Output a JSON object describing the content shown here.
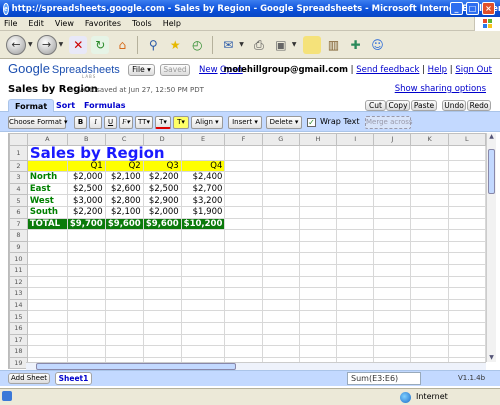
{
  "window": {
    "title": "http://spreadsheets.google.com - Sales by Region - Google Spreadsheets - Microsoft Internet Explorer"
  },
  "menu": [
    "File",
    "Edit",
    "View",
    "Favorites",
    "Tools",
    "Help"
  ],
  "app": {
    "logo_google": "Google",
    "logo_product": "Spreadsheets",
    "logo_sub": "LABS",
    "file_button": "File ▾",
    "saved_button": "Saved",
    "new_link": "New",
    "open_link": "Open",
    "account_email": "molehillgroup@gmail.com",
    "links": {
      "feedback": "Send feedback",
      "help": "Help",
      "signout": "Sign Out"
    },
    "doc_title": "Sales by Region",
    "autosave": "Autosaved at Jun 27, 12:50 PM PDT",
    "sharing": "Show sharing options"
  },
  "tabs": [
    "Format",
    "Sort",
    "Formulas"
  ],
  "edit_buttons": [
    "Cut",
    "Copy",
    "Paste",
    "Undo",
    "Redo"
  ],
  "format_toolbar": {
    "choose_format": "Choose Format ▾",
    "bold": "B",
    "italic": "I",
    "underline": "U",
    "font": "F▾",
    "size": "TT▾",
    "text_color": "T▾",
    "bg_color": "T▾",
    "align": "Align ▾",
    "insert": "Insert ▾",
    "delete": "Delete ▾",
    "wrap_text": "Wrap Text",
    "merge": "Merge across"
  },
  "grid": {
    "columns": [
      "A",
      "B",
      "C",
      "D",
      "E",
      "F",
      "G",
      "H",
      "I",
      "J",
      "K",
      "L"
    ],
    "title": "Sales by Region",
    "headers": [
      "",
      "Q1",
      "Q2",
      "Q3",
      "Q4"
    ],
    "rows": [
      [
        "North",
        "$2,000",
        "$2,100",
        "$2,200",
        "$2,400"
      ],
      [
        "East",
        "$2,500",
        "$2,600",
        "$2,500",
        "$2,700"
      ],
      [
        "West",
        "$3,000",
        "$2,800",
        "$2,900",
        "$3,200"
      ],
      [
        "South",
        "$2,200",
        "$2,100",
        "$2,000",
        "$1,900"
      ]
    ],
    "total": [
      "TOTAL",
      "$9,700",
      "$9,600",
      "$9,600",
      "$10,200"
    ],
    "row_count": 20
  },
  "bottom": {
    "add_sheet": "Add Sheet",
    "sheet_tab": "Sheet1 ▾",
    "formula": "Sum(E3:E6)",
    "version": "V1.1.4b"
  },
  "status": {
    "zone": "Internet"
  },
  "colors": {
    "title_text": "#1a1aff",
    "header_bg": "#ffff00",
    "label_green": "#008000",
    "total_bg": "#0b7a0b",
    "toolbar_blue": "#c3d9ff"
  }
}
